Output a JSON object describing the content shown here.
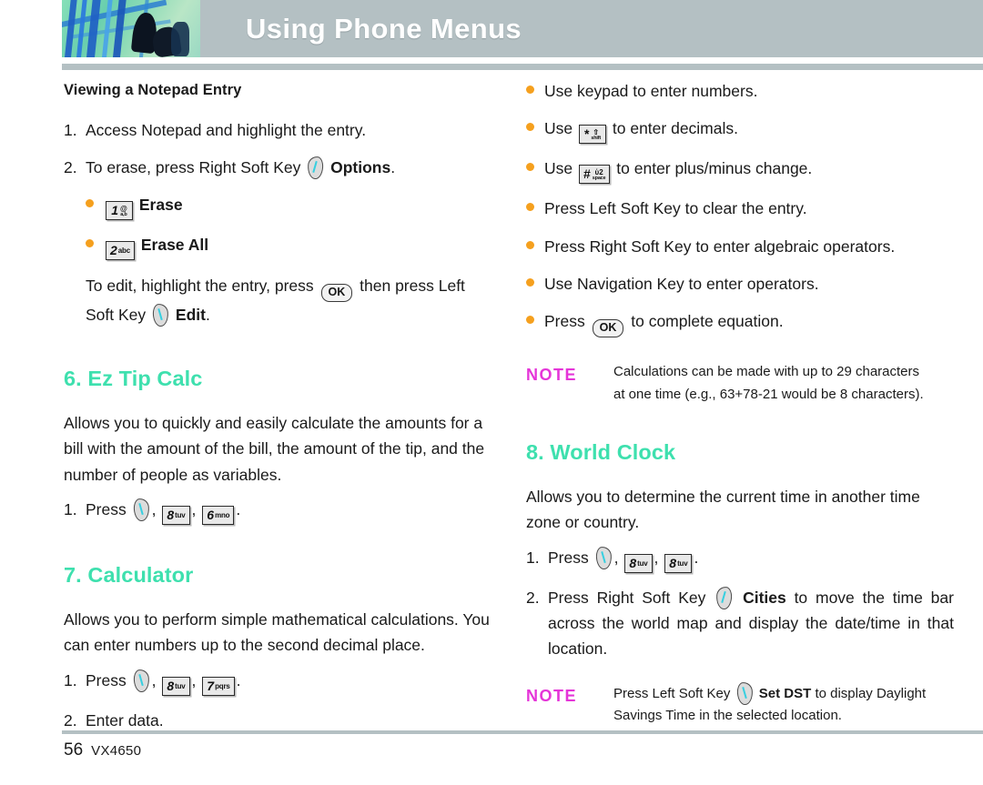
{
  "header": {
    "title": "Using Phone Menus",
    "photo_alt": "abstract-blue-green-photo"
  },
  "left_column": {
    "subheading": "Viewing a Notepad Entry",
    "steps": [
      {
        "num": "1.",
        "text": "Access Notepad and highlight the entry."
      },
      {
        "num": "2.",
        "text_before": "To erase, press Right Soft Key",
        "key": "right-soft-key",
        "text_bold": "Options",
        "text_after": "."
      }
    ],
    "erase_bullets": [
      {
        "key_digit": "1",
        "key_sub_top": "@",
        "key_sub_bottom": "a,b",
        "label": "Erase"
      },
      {
        "key_digit": "2",
        "key_sup": "abc",
        "label": "Erase All"
      }
    ],
    "edit_note": {
      "part1": "To edit, highlight the entry, press",
      "ok_key": "OK",
      "part2": "then press Left",
      "part3": "Soft Key",
      "bold": "Edit",
      "part4": "."
    },
    "section6": {
      "heading": "6. Ez Tip Calc",
      "paragraph": "Allows you to quickly and easily calculate the amounts for a bill with the amount of the bill, the amount of the tip, and the number of people as variables.",
      "step_num": "1.",
      "step_label": "Press",
      "keys": [
        {
          "digit": "8",
          "sup": "tuv"
        },
        {
          "digit": "6",
          "sup": "mno"
        }
      ]
    },
    "section7": {
      "heading": "7. Calculator",
      "paragraph": "Allows you to perform simple mathematical calculations. You can enter numbers up to the second decimal place.",
      "step1_num": "1.",
      "step1_label": "Press",
      "keys": [
        {
          "digit": "8",
          "sup": "tuv"
        },
        {
          "digit": "7",
          "sup": "pqrs"
        }
      ],
      "step2_num": "2.",
      "step2_text": "Enter data."
    }
  },
  "right_column": {
    "calc_bullets": [
      {
        "text": "Use keypad to enter numbers."
      },
      {
        "text_before": "Use",
        "key": "star-key",
        "key_glyph": "*",
        "key_sub_top": "⇧",
        "key_sub_bottom": "shift",
        "text_after": "to enter decimals."
      },
      {
        "text_before": "Use",
        "key": "pound-key",
        "key_glyph": "#",
        "key_sub_top": "ὑ2",
        "key_sub_bottom": "space",
        "text_after": "to enter plus/minus change."
      },
      {
        "text": "Press Left Soft Key to clear the entry."
      },
      {
        "text": "Press Right Soft Key to enter algebraic operators."
      },
      {
        "text": "Use Navigation Key to enter operators."
      },
      {
        "text_before": "Press",
        "key": "ok-key",
        "key_glyph": "OK",
        "text_after": "to complete equation."
      }
    ],
    "note1": {
      "label": "NOTE",
      "line1": "Calculations can be made with up to 29 characters",
      "line2": "at one time (e.g., 63+78-21 would be 8 characters)."
    },
    "section8": {
      "heading": "8. World Clock",
      "paragraph": "Allows you to determine the current time in another time zone or country.",
      "step1_num": "1.",
      "step1_label": "Press",
      "keys": [
        {
          "digit": "8",
          "sup": "tuv"
        },
        {
          "digit": "8",
          "sup": "tuv"
        }
      ],
      "step2_num": "2.",
      "step2_before": "Press Right Soft Key",
      "step2_bold": "Cities",
      "step2_after": "to move the time bar across the world map and display the date/time in that location."
    },
    "note2": {
      "label": "NOTE",
      "before": "Press Left Soft Key",
      "bold": "Set DST",
      "after": "to display Daylight Savings Time in the selected location."
    }
  },
  "footer": {
    "page_number": "56",
    "model": "VX4650"
  },
  "colors": {
    "header_bar": "#b4c0c3",
    "section_heading": "#3ee0ae",
    "note_label": "#e535d8",
    "bullet": "#f5a01e",
    "softkey_slash": "#37cfe0"
  }
}
